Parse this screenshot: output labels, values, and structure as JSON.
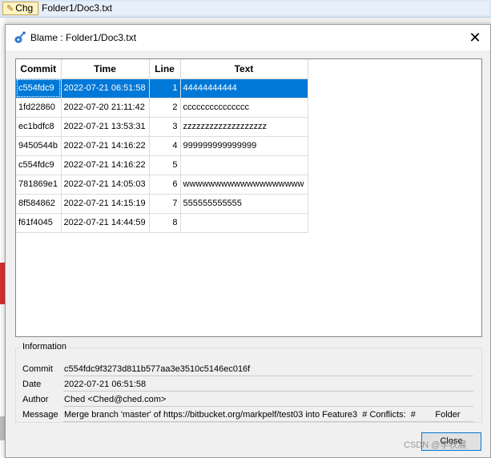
{
  "app": {
    "chg_label": "Chg",
    "path": "Folder1/Doc3.txt"
  },
  "dialog": {
    "title": "Blame : Folder1/Doc3.txt",
    "close_symbol": "✕",
    "close_button_label": "Close"
  },
  "table": {
    "headers": {
      "commit": "Commit",
      "time": "Time",
      "line": "Line",
      "text": "Text"
    },
    "rows": [
      {
        "commit": "c554fdc9",
        "time": "2022-07-21 06:51:58",
        "line": "1",
        "text": "44444444444"
      },
      {
        "commit": "1fd22860",
        "time": "2022-07-20 21:11:42",
        "line": "2",
        "text": "ccccccccccccccc"
      },
      {
        "commit": "ec1bdfc8",
        "time": "2022-07-21 13:53:31",
        "line": "3",
        "text": "zzzzzzzzzzzzzzzzzzz"
      },
      {
        "commit": "9450544b",
        "time": "2022-07-21 14:16:22",
        "line": "4",
        "text": "999999999999999"
      },
      {
        "commit": "c554fdc9",
        "time": "2022-07-21 14:16:22",
        "line": "5",
        "text": ""
      },
      {
        "commit": "781869e1",
        "time": "2022-07-21 14:05:03",
        "line": "6",
        "text": "wwwwwwwwwwwwwwwwwww"
      },
      {
        "commit": "8f584862",
        "time": "2022-07-21 14:15:19",
        "line": "7",
        "text": "555555555555"
      },
      {
        "commit": "f61f4045",
        "time": "2022-07-21 14:44:59",
        "line": "8",
        "text": ""
      }
    ]
  },
  "information": {
    "legend": "Information",
    "commit_label": "Commit",
    "commit_value": "c554fdc9f3273d811b577aa3e3510c5146ec016f",
    "date_label": "Date",
    "date_value": "2022-07-21 06:51:58",
    "author_label": "Author",
    "author_value": "Ched <Ched@ched.com>",
    "message_label": "Message",
    "message_value": "Merge branch 'master' of https://bitbucket.org/markpelf/test03 into Feature3  # Conflicts:  #        Folder"
  },
  "watermark": "CSDN @李秋展",
  "colors": {
    "selection": "#0078d7",
    "accent": "#0078d7"
  }
}
